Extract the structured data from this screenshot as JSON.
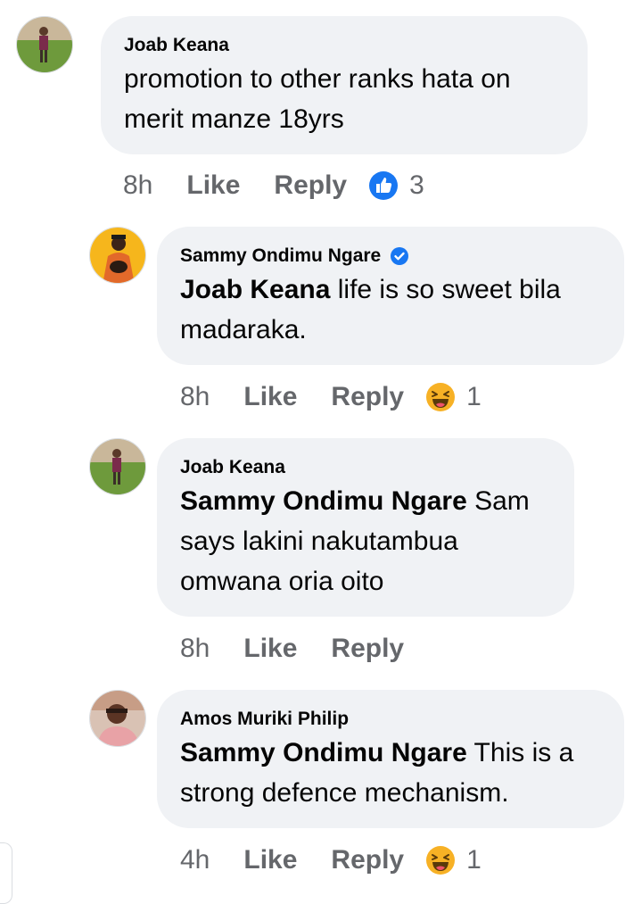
{
  "comments": [
    {
      "author": "Joab Keana",
      "text": "promotion to other ranks hata on merit manze 18yrs",
      "time": "8h",
      "like_label": "Like",
      "reply_label": "Reply",
      "reaction": {
        "icon": "like-reaction-icon",
        "count": "3"
      }
    },
    {
      "author": "Sammy Ondimu Ngare",
      "verified": true,
      "mention": "Joab Keana",
      "text": " life is so sweet bila madaraka.",
      "time": "8h",
      "like_label": "Like",
      "reply_label": "Reply",
      "reaction": {
        "icon": "haha-reaction-icon",
        "count": "1"
      }
    },
    {
      "author": "Joab Keana",
      "mention": "Sammy Ondimu Ngare",
      "text": " Sam says lakini nakutambua omwana oria oito",
      "time": "8h",
      "like_label": "Like",
      "reply_label": "Reply"
    },
    {
      "author": "Amos Muriki Philip",
      "mention": "Sammy Ondimu Ngare",
      "text": " This is a strong defence mechanism.",
      "time": "4h",
      "like_label": "Like",
      "reply_label": "Reply",
      "reaction": {
        "icon": "haha-reaction-icon",
        "count": "1"
      }
    }
  ],
  "colors": {
    "bubble": "#f0f2f5",
    "meta_text": "#65676b",
    "like_blue": "#1877f2",
    "haha_yellow": "#f7b125"
  }
}
